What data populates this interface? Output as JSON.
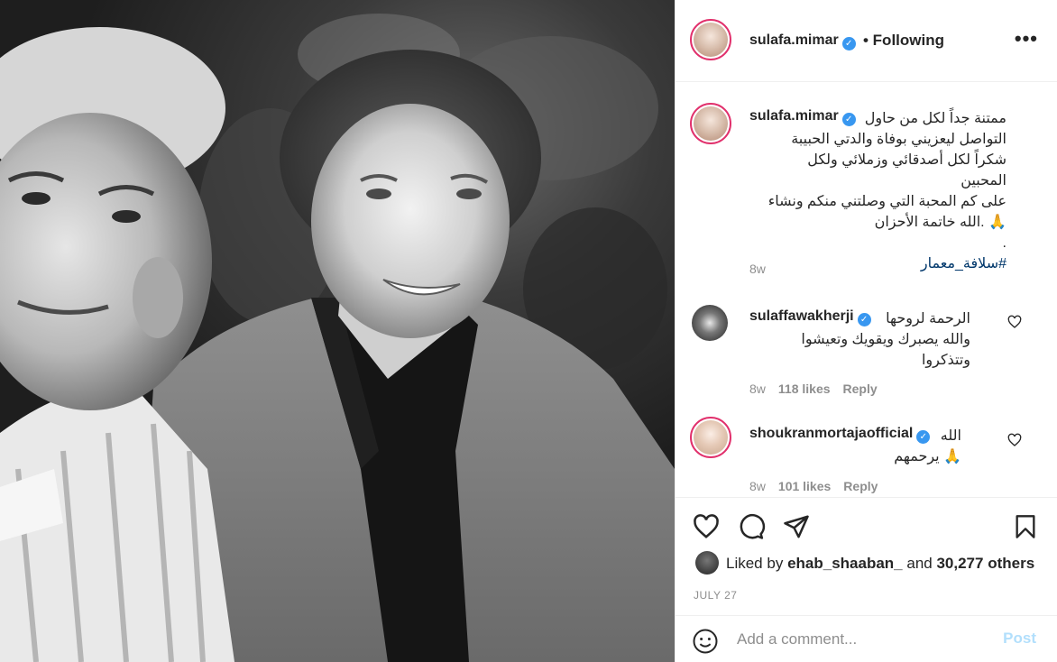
{
  "header": {
    "username": "sulafa.mimar",
    "follow_status": "• Following",
    "more_icon": "more-horizontal-icon"
  },
  "caption": {
    "username": "sulafa.mimar",
    "text_lines": [
      "ممتنة جداً لكل من حاول",
      "التواصل ليعزيني بوفاة والدتي الحبيبة",
      "شكراً لكل أصدقائي وزملائي ولكل المحبين",
      "على كم المحبة التي وصلتني منكم ونشاء",
      "🙏 .الله خاتمة الأحزان",
      "."
    ],
    "hashtag": "#سلافة_معمار",
    "age": "8w"
  },
  "comments": [
    {
      "username": "sulaffawakherji",
      "lines": [
        "الرحمة لروحها",
        "والله يصبرك ويقويك وتعيشوا",
        "وتتذكروا"
      ],
      "age": "8w",
      "likes": "118 likes",
      "reply": "Reply"
    },
    {
      "username": "shoukranmortajaofficial",
      "lines": [
        "الله",
        "🙏 يرحمهم"
      ],
      "age": "8w",
      "likes": "101 likes",
      "reply": "Reply"
    }
  ],
  "actions": {
    "liked_by_prefix": "Liked by",
    "liked_by_user": "ehab_shaaban_",
    "liked_by_and": "and",
    "liked_by_count": "30,277 others",
    "date": "JULY 27"
  },
  "composer": {
    "placeholder": "Add a comment...",
    "post_label": "Post"
  },
  "colors": {
    "verified": "#3897f0",
    "link": "#00376b",
    "muted": "#8e8e8e",
    "post_disabled": "#b2dffc"
  }
}
